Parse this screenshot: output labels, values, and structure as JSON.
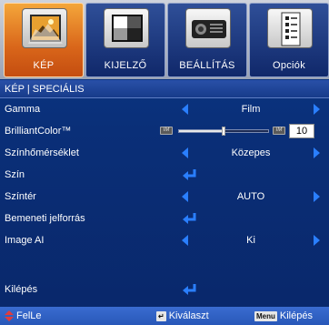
{
  "tabs": [
    {
      "label": "KÉP",
      "icon": "picture-icon",
      "active": true
    },
    {
      "label": "KIJELZŐ",
      "icon": "display-icon",
      "active": false
    },
    {
      "label": "BEÁLLÍTÁS",
      "icon": "projector-icon",
      "active": false
    },
    {
      "label": "Opciók",
      "icon": "options-icon",
      "active": false
    }
  ],
  "section_title": "KÉP | SPECIÁLIS",
  "rows": {
    "gamma": {
      "label": "Gamma",
      "value": "Film"
    },
    "brilliantcolor": {
      "label": "BrilliantColor™",
      "value": "10",
      "level": 0.5,
      "badge": "IM"
    },
    "szinhomerseklet": {
      "label": "Színhőmérséklet",
      "value": "Közepes"
    },
    "szin": {
      "label": "Szín"
    },
    "szinter": {
      "label": "Színtér",
      "value": "AUTO"
    },
    "bemeneti": {
      "label": "Bemeneti jelforrás"
    },
    "imageai": {
      "label": "Image AI",
      "value": "Ki"
    },
    "kilepes": {
      "label": "Kilépés"
    }
  },
  "footer": {
    "select_label": "FelLe",
    "enter_label": "Kiválaszt",
    "menu_key": "Menu",
    "exit_label": "Kilépés"
  },
  "colors": {
    "accent": "#2a7fff",
    "active_tab": "#e07a20",
    "background": "#0a2f78"
  }
}
